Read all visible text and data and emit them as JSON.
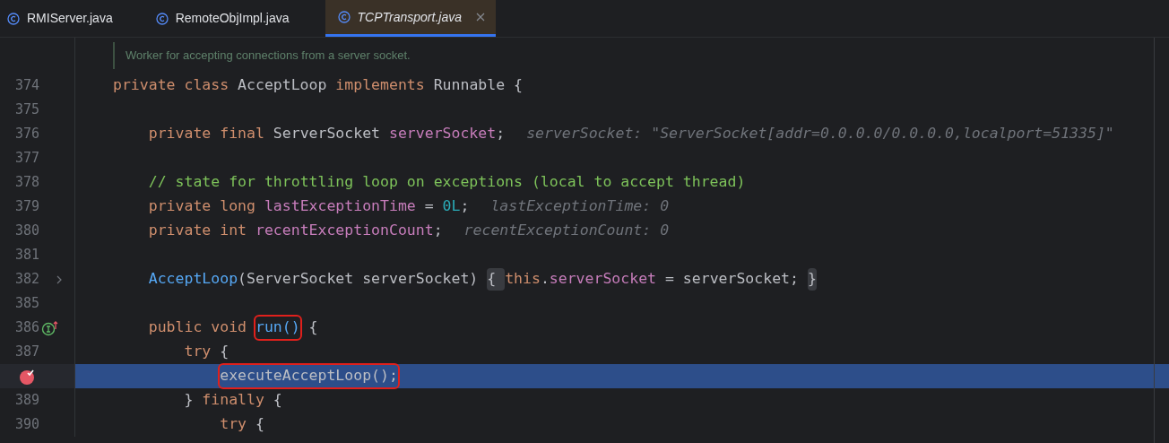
{
  "tabs": [
    {
      "label": "RMIServer.java",
      "selected": false
    },
    {
      "label": "RemoteObjImpl.java",
      "selected": false
    },
    {
      "label": "TCPTransport.java",
      "selected": true,
      "closable": true
    }
  ],
  "doc_comment": "Worker for accepting connections from a server socket.",
  "lines": [
    {
      "number": "374",
      "current": false,
      "tokens": [
        {
          "text": "private class ",
          "kind": "keyword"
        },
        {
          "text": "AcceptLoop ",
          "kind": "plain"
        },
        {
          "text": "implements ",
          "kind": "keyword"
        },
        {
          "text": "Runnable {",
          "kind": "plain"
        }
      ]
    },
    {
      "number": "375",
      "current": false
    },
    {
      "number": "376",
      "current": false,
      "tokens": [
        {
          "text": "    private final ",
          "kind": "keyword"
        },
        {
          "text": "ServerSocket ",
          "kind": "plain"
        },
        {
          "text": "serverSocket",
          "kind": "field"
        },
        {
          "text": ";",
          "kind": "plain"
        },
        {
          "text": "serverSocket: \"ServerSocket[addr=0.0.0.0/0.0.0.0,localport=51335]\"",
          "kind": "hint"
        }
      ]
    },
    {
      "number": "377",
      "current": false
    },
    {
      "number": "378",
      "current": false,
      "tokens": [
        {
          "text": "    // state for throttling loop on exceptions (local to accept thread)",
          "kind": "comment"
        }
      ]
    },
    {
      "number": "379",
      "current": false,
      "tokens": [
        {
          "text": "    private long ",
          "kind": "keyword"
        },
        {
          "text": "lastExceptionTime",
          "kind": "field"
        },
        {
          "text": " = ",
          "kind": "plain"
        },
        {
          "text": "0L",
          "kind": "number"
        },
        {
          "text": ";",
          "kind": "plain"
        },
        {
          "text": "lastExceptionTime: 0",
          "kind": "hint"
        }
      ]
    },
    {
      "number": "380",
      "current": false,
      "tokens": [
        {
          "text": "    private int ",
          "kind": "keyword"
        },
        {
          "text": "recentExceptionCount",
          "kind": "field"
        },
        {
          "text": ";",
          "kind": "plain"
        },
        {
          "text": "recentExceptionCount: 0",
          "kind": "hint"
        }
      ]
    },
    {
      "number": "381",
      "current": false
    },
    {
      "number": "382",
      "fold": true,
      "current": false,
      "tokens": [
        {
          "text": "    AcceptLoop",
          "kind": "method"
        },
        {
          "text": "(ServerSocket serverSocket)",
          "kind": "plain"
        },
        {
          "text": " { ",
          "kind": "fold"
        },
        {
          "text": "this",
          "kind": "keyword"
        },
        {
          "text": ".",
          "kind": "plain"
        },
        {
          "text": "serverSocket",
          "kind": "field"
        },
        {
          "text": " = serverSocket;",
          "kind": "plain"
        },
        {
          "text": " }",
          "kind": "fold"
        }
      ]
    },
    {
      "number": "385",
      "current": false
    },
    {
      "number": "386",
      "implements_marker": true,
      "current": false,
      "tokens": [
        {
          "text": "    public void ",
          "kind": "keyword"
        },
        {
          "text": "run()",
          "kind": "boxed-method"
        },
        {
          "text": " {",
          "kind": "plain"
        }
      ]
    },
    {
      "number": "387",
      "current": false,
      "tokens": [
        {
          "text": "        try ",
          "kind": "keyword"
        },
        {
          "text": "{",
          "kind": "plain"
        }
      ]
    },
    {
      "breakpoint": true,
      "current": true,
      "tokens": [
        {
          "text": "            executeAcceptLoop();",
          "kind": "boxed"
        }
      ]
    },
    {
      "number": "389",
      "current": false,
      "tokens": [
        {
          "text": "        } ",
          "kind": "plain"
        },
        {
          "text": "finally ",
          "kind": "keyword"
        },
        {
          "text": "{",
          "kind": "plain"
        }
      ]
    },
    {
      "number": "390",
      "current": false,
      "tokens": [
        {
          "text": "            try ",
          "kind": "keyword"
        },
        {
          "text": "{",
          "kind": "plain"
        }
      ]
    }
  ]
}
